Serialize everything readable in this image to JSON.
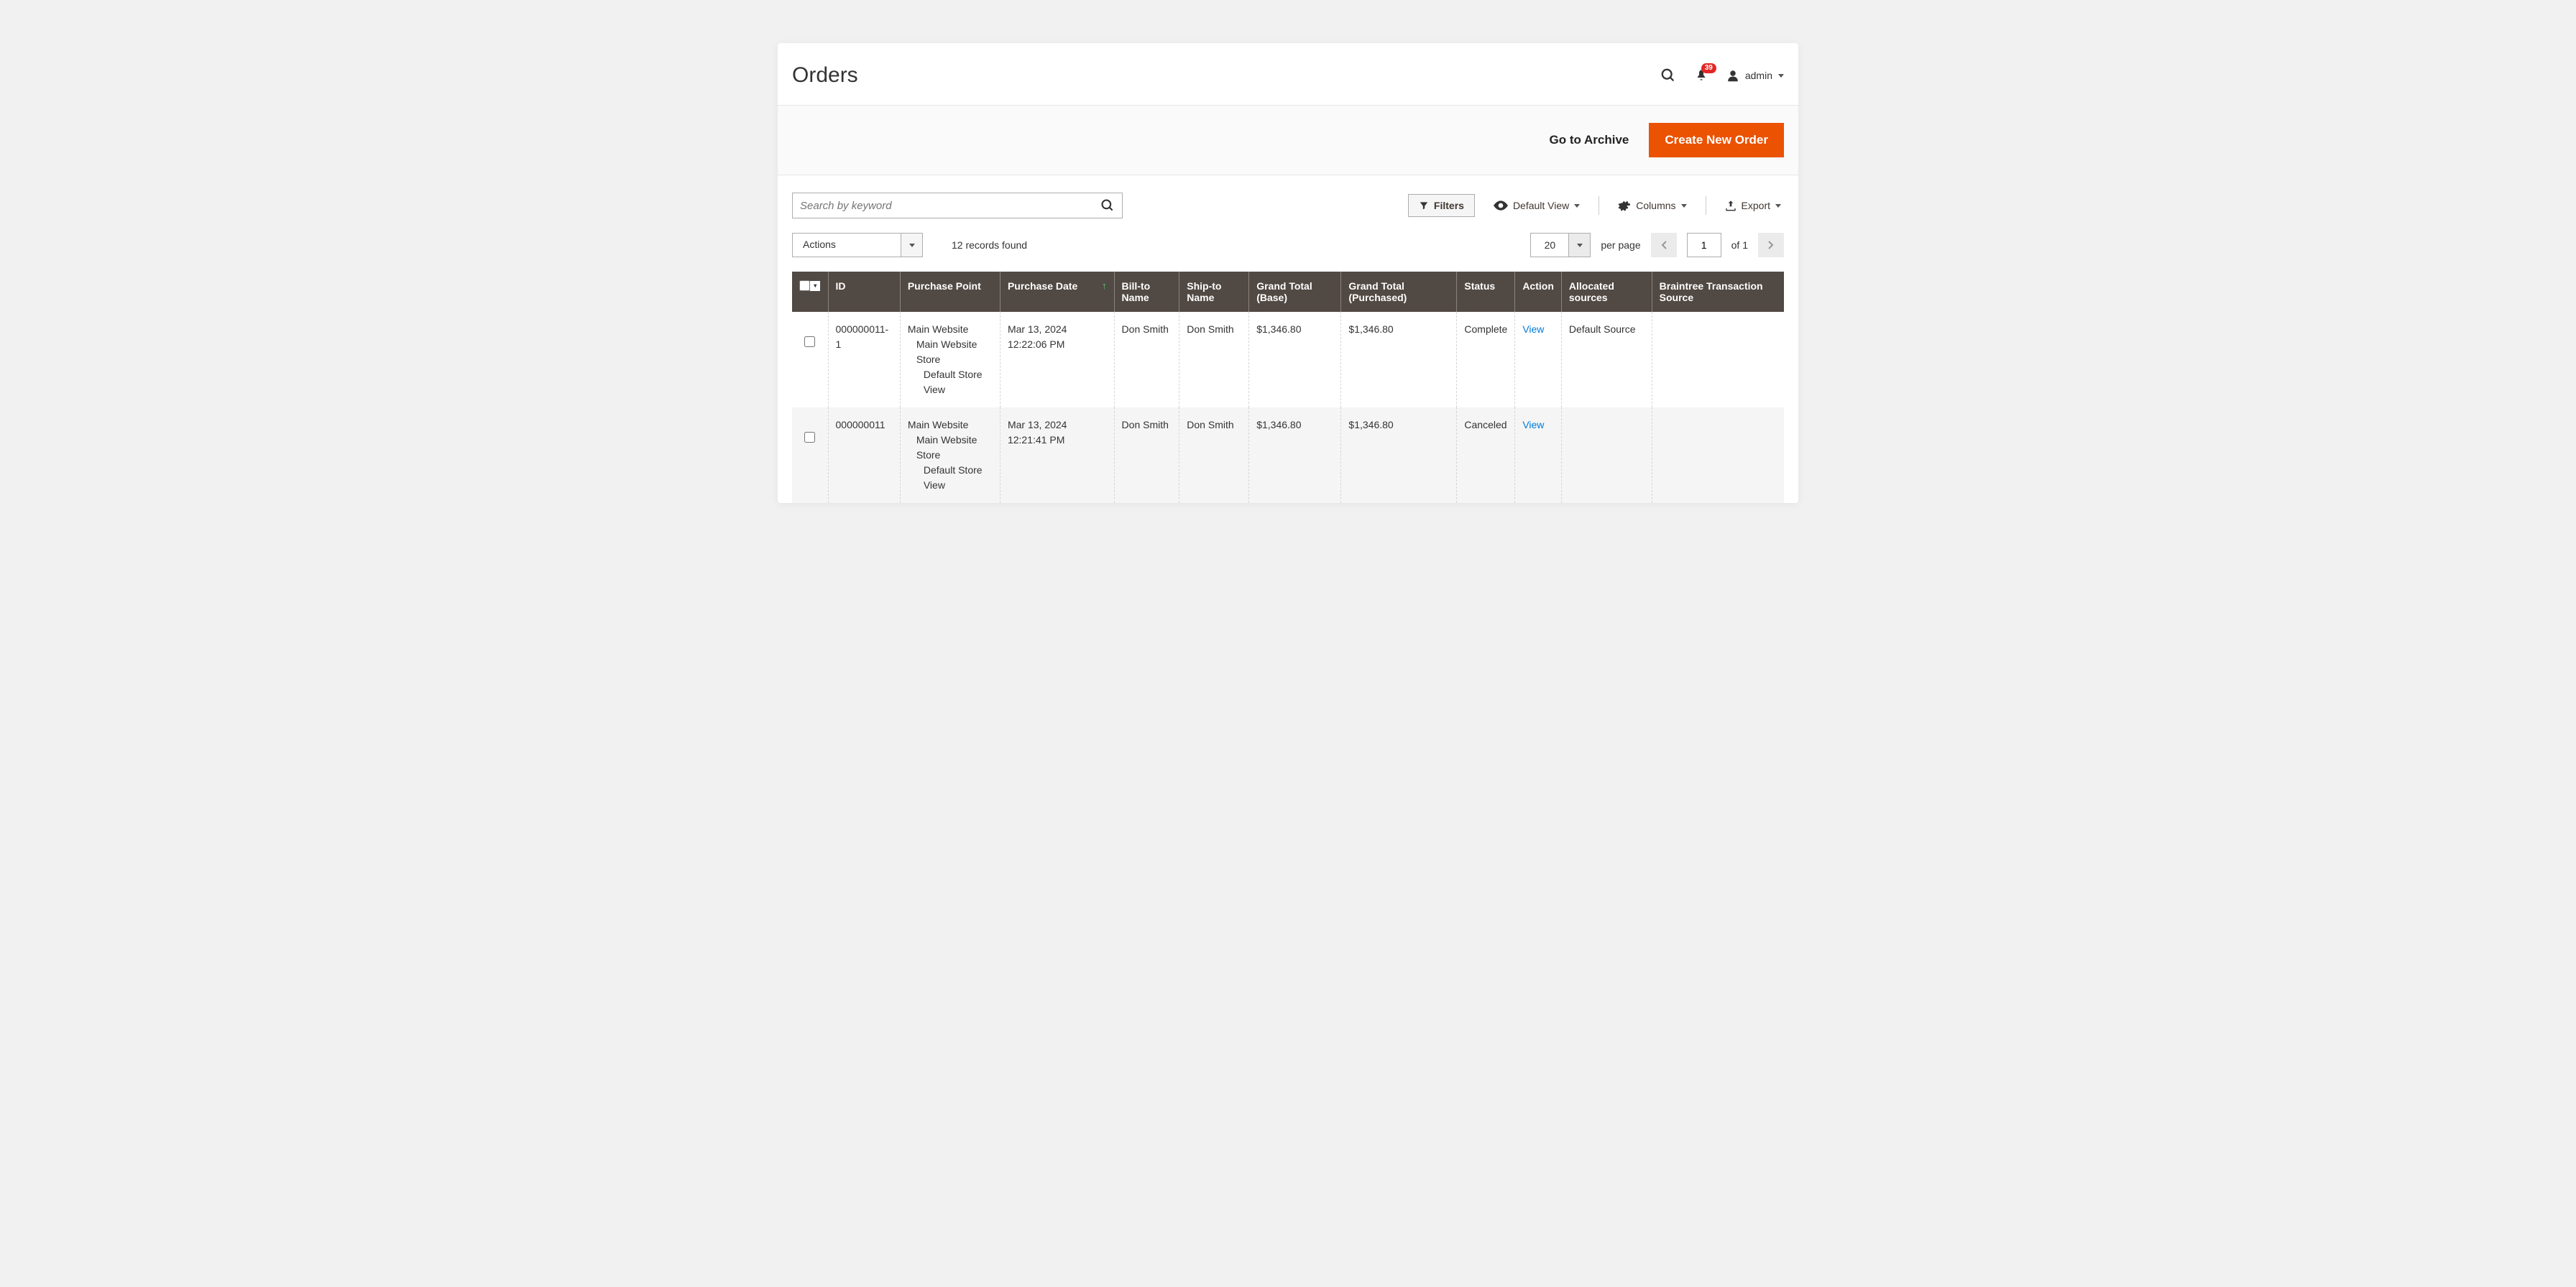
{
  "header": {
    "title": "Orders",
    "notif_count": "39",
    "user_name": "admin"
  },
  "action_bar": {
    "archive_link": "Go to Archive",
    "create_btn": "Create New Order"
  },
  "toolbar": {
    "search_placeholder": "Search by keyword",
    "filters": "Filters",
    "default_view": "Default View",
    "columns": "Columns",
    "export": "Export"
  },
  "subbar": {
    "actions_label": "Actions",
    "records_found": "12 records found",
    "per_page_value": "20",
    "per_page_label": "per page",
    "page_value": "1",
    "of_text": "of 1"
  },
  "table": {
    "columns": {
      "id": "ID",
      "purchase_point": "Purchase Point",
      "purchase_date": "Purchase Date",
      "bill_to": "Bill-to Name",
      "ship_to": "Ship-to Name",
      "gt_base": "Grand Total (Base)",
      "gt_purch": "Grand Total (Purchased)",
      "status": "Status",
      "action": "Action",
      "alloc": "Allocated sources",
      "braintree": "Braintree Transaction Source"
    },
    "rows": [
      {
        "id": "000000011-1",
        "pp1": "Main Website",
        "pp2": "Main Website Store",
        "pp3": "Default Store View",
        "date": "Mar 13, 2024 12:22:06 PM",
        "bill_to": "Don Smith",
        "ship_to": "Don Smith",
        "gt_base": "$1,346.80",
        "gt_purch": "$1,346.80",
        "status": "Complete",
        "action": "View",
        "alloc": "Default Source",
        "braintree": ""
      },
      {
        "id": "000000011",
        "pp1": "Main Website",
        "pp2": "Main Website Store",
        "pp3": "Default Store View",
        "date": "Mar 13, 2024 12:21:41 PM",
        "bill_to": "Don Smith",
        "ship_to": "Don Smith",
        "gt_base": "$1,346.80",
        "gt_purch": "$1,346.80",
        "status": "Canceled",
        "action": "View",
        "alloc": "",
        "braintree": ""
      }
    ]
  }
}
